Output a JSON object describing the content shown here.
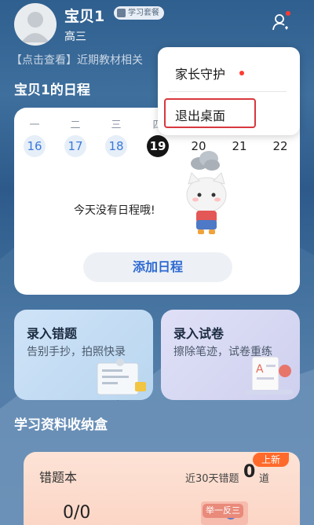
{
  "header": {
    "username": "宝贝1",
    "badge": "学习套餐",
    "grade": "高三",
    "notice": "【点击查看】近期教材相关"
  },
  "schedule": {
    "title": "宝贝1的日程",
    "weekdays": [
      "一",
      "二",
      "三",
      "四"
    ],
    "dates": [
      "16",
      "17",
      "18",
      "19",
      "20",
      "21",
      "22"
    ],
    "today": "19",
    "empty_text": "今天没有日程哦!",
    "add_button": "添加日程"
  },
  "menu": {
    "items": [
      "家长守护",
      "退出桌面"
    ]
  },
  "tiles": [
    {
      "title": "录入错题",
      "subtitle": "告别手抄，拍照快录"
    },
    {
      "title": "录入试卷",
      "subtitle": "擦除笔迹，试卷重练"
    }
  ],
  "storage": {
    "title": "学习资料收纳盒",
    "notebook": {
      "title": "错题本",
      "recent_label": "近30天错题",
      "recent_count": "0",
      "unit": "道",
      "fraction": "0/0",
      "new_badge": "上新",
      "promo_badge": "举一反三"
    }
  },
  "colors": {
    "accent": "#2f6ad1",
    "today_bg": "#151515",
    "highlight_border": "#d8383d",
    "notif_dot": "#ff3b30"
  }
}
